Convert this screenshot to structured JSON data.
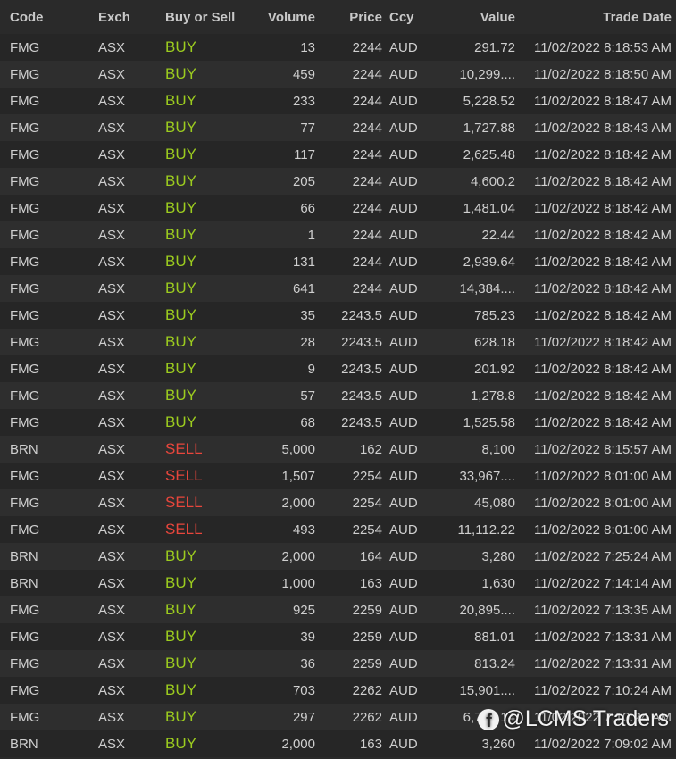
{
  "columns": {
    "code": "Code",
    "exch": "Exch",
    "side": "Buy or Sell",
    "volume": "Volume",
    "price": "Price",
    "ccy": "Ccy",
    "value": "Value",
    "trade_date": "Trade Date"
  },
  "rows": [
    {
      "code": "FMG",
      "exch": "ASX",
      "side": "BUY",
      "volume": "13",
      "price": "2244",
      "ccy": "AUD",
      "value": "291.72",
      "trade_date": "11/02/2022 8:18:53 AM"
    },
    {
      "code": "FMG",
      "exch": "ASX",
      "side": "BUY",
      "volume": "459",
      "price": "2244",
      "ccy": "AUD",
      "value": "10,299....",
      "trade_date": "11/02/2022 8:18:50 AM"
    },
    {
      "code": "FMG",
      "exch": "ASX",
      "side": "BUY",
      "volume": "233",
      "price": "2244",
      "ccy": "AUD",
      "value": "5,228.52",
      "trade_date": "11/02/2022 8:18:47 AM"
    },
    {
      "code": "FMG",
      "exch": "ASX",
      "side": "BUY",
      "volume": "77",
      "price": "2244",
      "ccy": "AUD",
      "value": "1,727.88",
      "trade_date": "11/02/2022 8:18:43 AM"
    },
    {
      "code": "FMG",
      "exch": "ASX",
      "side": "BUY",
      "volume": "117",
      "price": "2244",
      "ccy": "AUD",
      "value": "2,625.48",
      "trade_date": "11/02/2022 8:18:42 AM"
    },
    {
      "code": "FMG",
      "exch": "ASX",
      "side": "BUY",
      "volume": "205",
      "price": "2244",
      "ccy": "AUD",
      "value": "4,600.2",
      "trade_date": "11/02/2022 8:18:42 AM"
    },
    {
      "code": "FMG",
      "exch": "ASX",
      "side": "BUY",
      "volume": "66",
      "price": "2244",
      "ccy": "AUD",
      "value": "1,481.04",
      "trade_date": "11/02/2022 8:18:42 AM"
    },
    {
      "code": "FMG",
      "exch": "ASX",
      "side": "BUY",
      "volume": "1",
      "price": "2244",
      "ccy": "AUD",
      "value": "22.44",
      "trade_date": "11/02/2022 8:18:42 AM"
    },
    {
      "code": "FMG",
      "exch": "ASX",
      "side": "BUY",
      "volume": "131",
      "price": "2244",
      "ccy": "AUD",
      "value": "2,939.64",
      "trade_date": "11/02/2022 8:18:42 AM"
    },
    {
      "code": "FMG",
      "exch": "ASX",
      "side": "BUY",
      "volume": "641",
      "price": "2244",
      "ccy": "AUD",
      "value": "14,384....",
      "trade_date": "11/02/2022 8:18:42 AM"
    },
    {
      "code": "FMG",
      "exch": "ASX",
      "side": "BUY",
      "volume": "35",
      "price": "2243.5",
      "ccy": "AUD",
      "value": "785.23",
      "trade_date": "11/02/2022 8:18:42 AM"
    },
    {
      "code": "FMG",
      "exch": "ASX",
      "side": "BUY",
      "volume": "28",
      "price": "2243.5",
      "ccy": "AUD",
      "value": "628.18",
      "trade_date": "11/02/2022 8:18:42 AM"
    },
    {
      "code": "FMG",
      "exch": "ASX",
      "side": "BUY",
      "volume": "9",
      "price": "2243.5",
      "ccy": "AUD",
      "value": "201.92",
      "trade_date": "11/02/2022 8:18:42 AM"
    },
    {
      "code": "FMG",
      "exch": "ASX",
      "side": "BUY",
      "volume": "57",
      "price": "2243.5",
      "ccy": "AUD",
      "value": "1,278.8",
      "trade_date": "11/02/2022 8:18:42 AM"
    },
    {
      "code": "FMG",
      "exch": "ASX",
      "side": "BUY",
      "volume": "68",
      "price": "2243.5",
      "ccy": "AUD",
      "value": "1,525.58",
      "trade_date": "11/02/2022 8:18:42 AM"
    },
    {
      "code": "BRN",
      "exch": "ASX",
      "side": "SELL",
      "volume": "5,000",
      "price": "162",
      "ccy": "AUD",
      "value": "8,100",
      "trade_date": "11/02/2022 8:15:57 AM"
    },
    {
      "code": "FMG",
      "exch": "ASX",
      "side": "SELL",
      "volume": "1,507",
      "price": "2254",
      "ccy": "AUD",
      "value": "33,967....",
      "trade_date": "11/02/2022 8:01:00 AM"
    },
    {
      "code": "FMG",
      "exch": "ASX",
      "side": "SELL",
      "volume": "2,000",
      "price": "2254",
      "ccy": "AUD",
      "value": "45,080",
      "trade_date": "11/02/2022 8:01:00 AM"
    },
    {
      "code": "FMG",
      "exch": "ASX",
      "side": "SELL",
      "volume": "493",
      "price": "2254",
      "ccy": "AUD",
      "value": "11,112.22",
      "trade_date": "11/02/2022 8:01:00 AM"
    },
    {
      "code": "BRN",
      "exch": "ASX",
      "side": "BUY",
      "volume": "2,000",
      "price": "164",
      "ccy": "AUD",
      "value": "3,280",
      "trade_date": "11/02/2022 7:25:24 AM"
    },
    {
      "code": "BRN",
      "exch": "ASX",
      "side": "BUY",
      "volume": "1,000",
      "price": "163",
      "ccy": "AUD",
      "value": "1,630",
      "trade_date": "11/02/2022 7:14:14 AM"
    },
    {
      "code": "FMG",
      "exch": "ASX",
      "side": "BUY",
      "volume": "925",
      "price": "2259",
      "ccy": "AUD",
      "value": "20,895....",
      "trade_date": "11/02/2022 7:13:35 AM"
    },
    {
      "code": "FMG",
      "exch": "ASX",
      "side": "BUY",
      "volume": "39",
      "price": "2259",
      "ccy": "AUD",
      "value": "881.01",
      "trade_date": "11/02/2022 7:13:31 AM"
    },
    {
      "code": "FMG",
      "exch": "ASX",
      "side": "BUY",
      "volume": "36",
      "price": "2259",
      "ccy": "AUD",
      "value": "813.24",
      "trade_date": "11/02/2022 7:13:31 AM"
    },
    {
      "code": "FMG",
      "exch": "ASX",
      "side": "BUY",
      "volume": "703",
      "price": "2262",
      "ccy": "AUD",
      "value": "15,901....",
      "trade_date": "11/02/2022 7:10:24 AM"
    },
    {
      "code": "FMG",
      "exch": "ASX",
      "side": "BUY",
      "volume": "297",
      "price": "2262",
      "ccy": "AUD",
      "value": "6,718.14",
      "trade_date": "11/02/2022 7:10:24 AM"
    },
    {
      "code": "BRN",
      "exch": "ASX",
      "side": "BUY",
      "volume": "2,000",
      "price": "163",
      "ccy": "AUD",
      "value": "3,260",
      "trade_date": "11/02/2022 7:09:02 AM"
    }
  ],
  "colors": {
    "buy": "#9ccc1f",
    "sell": "#e8463c",
    "background": "#2a2a2a"
  },
  "watermark": {
    "icon": "facebook-icon",
    "text": "@LCMS Traders"
  }
}
